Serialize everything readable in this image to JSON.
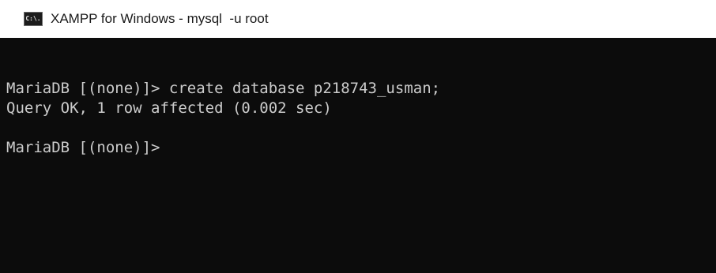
{
  "window": {
    "icon_text": "C:\\.",
    "title": "XAMPP for Windows - mysql  -u root"
  },
  "console": {
    "lines": [
      "MariaDB [(none)]> create database p218743_usman;",
      "Query OK, 1 row affected (0.002 sec)",
      "",
      "MariaDB [(none)]>"
    ]
  },
  "colors": {
    "console_background": "#0c0c0c",
    "console_text": "#cccccc",
    "titlebar_background": "#ffffff"
  }
}
